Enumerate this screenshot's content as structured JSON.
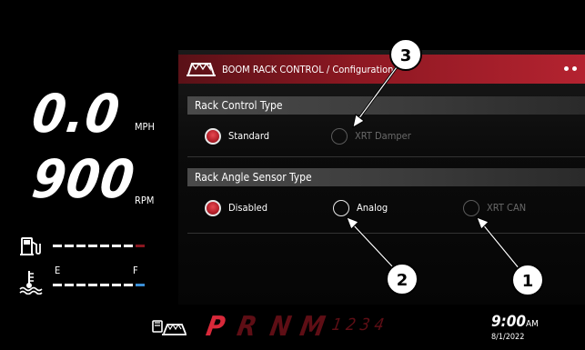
{
  "gauges": {
    "speed_value": "0.0",
    "speed_unit": "MPH",
    "rpm_value": "900",
    "rpm_unit": "RPM",
    "fuel_icon": "fuel-pump-icon",
    "coolant_icon": "coolant-temperature-icon",
    "coolant_scale_left": "E",
    "coolant_scale_right": "F"
  },
  "header": {
    "title": "BOOM RACK CONTROL / Configuration",
    "icon": "boom-rack-icon",
    "page_indicator": {
      "count": 2,
      "active": 1
    }
  },
  "sections": [
    {
      "label": "Rack Control Type",
      "options": [
        {
          "label": "Standard",
          "state": "selected"
        },
        {
          "label": "XRT Damper",
          "state": "disabled"
        }
      ]
    },
    {
      "label": "Rack Angle Sensor Type",
      "options": [
        {
          "label": "Disabled",
          "state": "selected"
        },
        {
          "label": "Analog",
          "state": "enabled"
        },
        {
          "label": "XRT CAN",
          "state": "disabled"
        }
      ]
    }
  ],
  "bottom": {
    "gear_icon": "boom-rack-status-icon",
    "gears": [
      "P",
      "R",
      "N",
      "M"
    ],
    "active_gear": "P",
    "manual_gears": "1 2 3 4",
    "time": "9:00",
    "ampm": "AM",
    "date": "8/1/2022"
  },
  "callouts": [
    "1",
    "2",
    "3"
  ],
  "colors": {
    "accent_red": "#b8222c",
    "header_red": "#8e1822",
    "coolant_blue": "#3a8ed6",
    "gear_red": "#c21f2b"
  }
}
